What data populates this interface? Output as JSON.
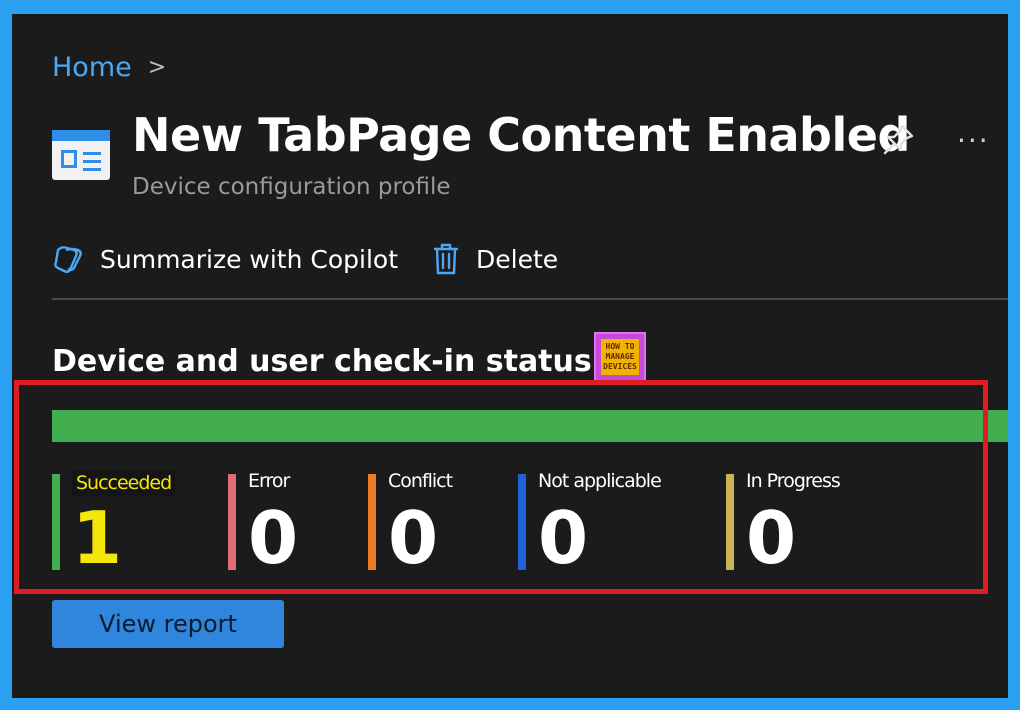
{
  "breadcrumb": {
    "home": "Home",
    "separator": ">"
  },
  "header": {
    "title": "New TabPage Content Enabled",
    "subtitle": "Device configuration profile",
    "page_icon": "profile-icon",
    "pin_icon": "pin-icon",
    "more_icon": "more-icon",
    "more_label": "···"
  },
  "toolbar": {
    "summarize_label": "Summarize with Copilot",
    "summarize_icon": "copilot-icon",
    "delete_label": "Delete",
    "delete_icon": "trash-icon"
  },
  "status": {
    "section_title": "Device and user check-in status",
    "progress_color": "#42ad4f",
    "succeeded_fraction": 1.0,
    "stats": [
      {
        "label": "Succeeded",
        "value": "1",
        "color": "#42ad4f"
      },
      {
        "label": "Error",
        "value": "0",
        "color": "#e06c75"
      },
      {
        "label": "Conflict",
        "value": "0",
        "color": "#f07a28"
      },
      {
        "label": "Not applicable",
        "value": "0",
        "color": "#1f62d8"
      },
      {
        "label": "In Progress",
        "value": "0",
        "color": "#c9b458"
      }
    ]
  },
  "logo": {
    "line1": "HOW TO",
    "line2": "MANAGE",
    "line3": "DEVICES"
  },
  "actions": {
    "view_report_label": "View report"
  },
  "colors": {
    "accent": "#2f86dc",
    "highlight_border": "#e01b24",
    "background": "#1b1b1b",
    "frame": "#2b9ff0"
  }
}
